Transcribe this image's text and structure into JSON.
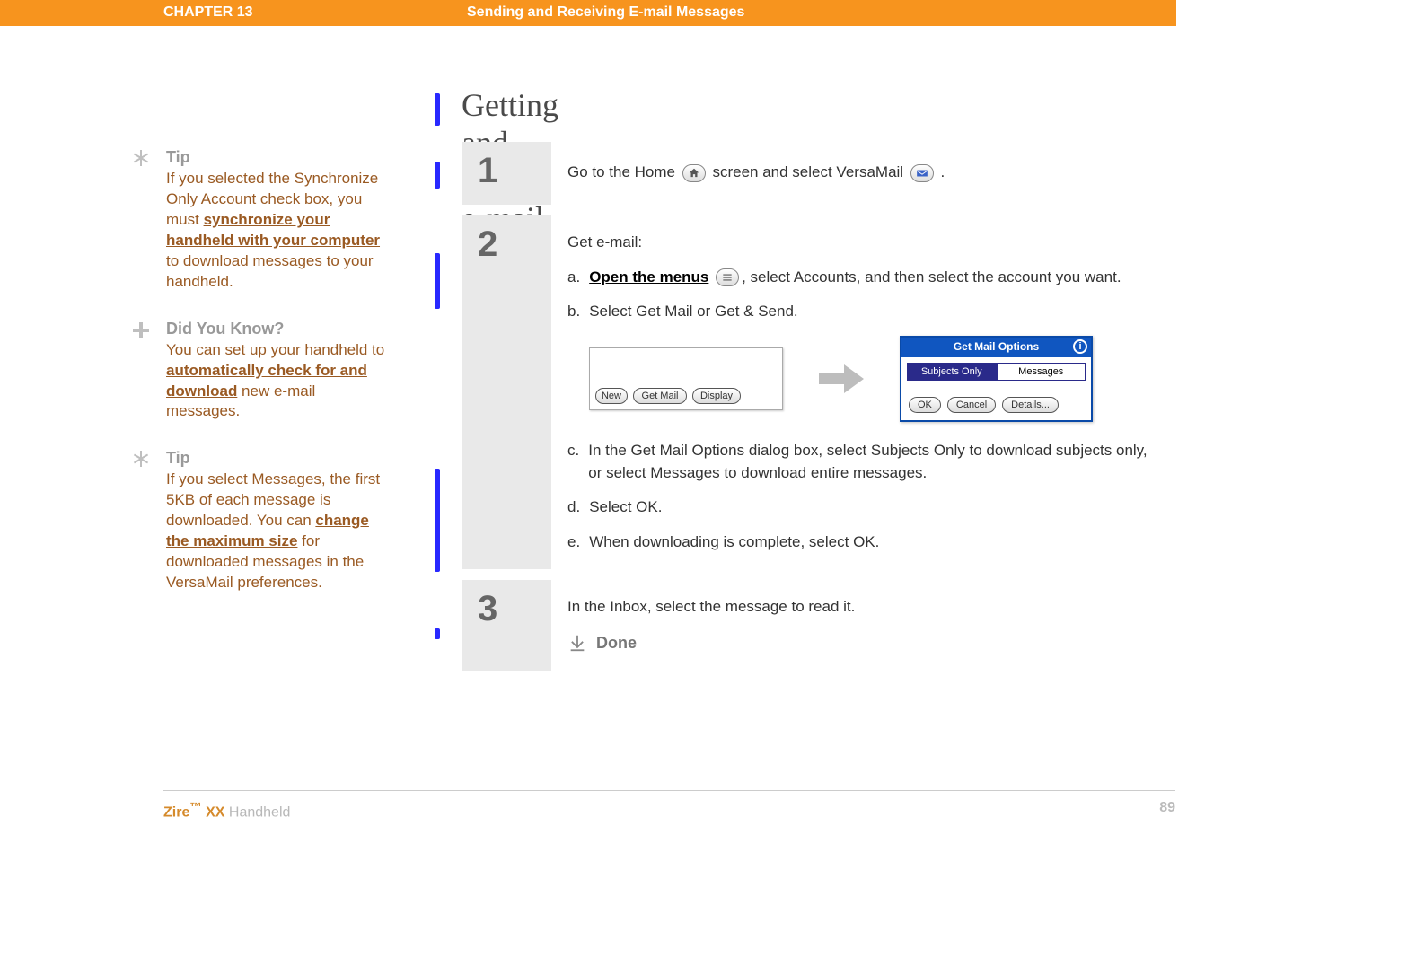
{
  "banner": {
    "chapter": "CHAPTER 13",
    "title": "Sending and Receiving E-mail Messages"
  },
  "sidebar": {
    "tip1": {
      "head": "Tip",
      "pre": "If you selected the Synchronize Only Account check box, you must ",
      "link": "synchronize your handheld with your computer",
      "post": " to download messages to your handheld."
    },
    "dyk": {
      "head": "Did You Know?",
      "pre": "You can set up your handheld to ",
      "link": "automatically check for and download",
      "post": " new e-mail messages."
    },
    "tip2": {
      "head": "Tip",
      "pre": "If you select Messages, the first 5KB of each message is downloaded. You can ",
      "link": "change the maximum size",
      "post": " for downloaded messages in the VersaMail preferences."
    }
  },
  "main": {
    "heading": "Getting and reading e-mail messages"
  },
  "steps": {
    "s1": {
      "num": "1",
      "pre": "Go to the Home ",
      "mid": " screen and select VersaMail  ",
      "post": "."
    },
    "s2": {
      "num": "2",
      "intro": "Get e-mail:",
      "a_letter": "a.",
      "a_link": "Open the menus",
      "a_rest": ", select Accounts, and then select the account you want.",
      "b_letter": "b.",
      "b_text": "Select Get Mail or Get & Send.",
      "c_letter": "c.",
      "c_text": "In the Get Mail Options dialog box, select Subjects Only to download subjects only, or select Messages to download entire messages.",
      "d_letter": "d.",
      "d_text": "Select OK.",
      "e_letter": "e.",
      "e_text": "When downloading is complete, select OK.",
      "palm": {
        "new": "New",
        "getmail": "Get Mail",
        "display": "Display"
      },
      "dialog": {
        "title": "Get Mail Options",
        "tab1": "Subjects Only",
        "tab2": "Messages",
        "ok": "OK",
        "cancel": "Cancel",
        "details": "Details..."
      }
    },
    "s3": {
      "num": "3",
      "text": "In the Inbox, select the message to read it.",
      "done": "Done"
    }
  },
  "footer": {
    "brand1": "Zire",
    "tm": "™",
    "brand2": " XX ",
    "hand": "Handheld",
    "page": "89"
  }
}
